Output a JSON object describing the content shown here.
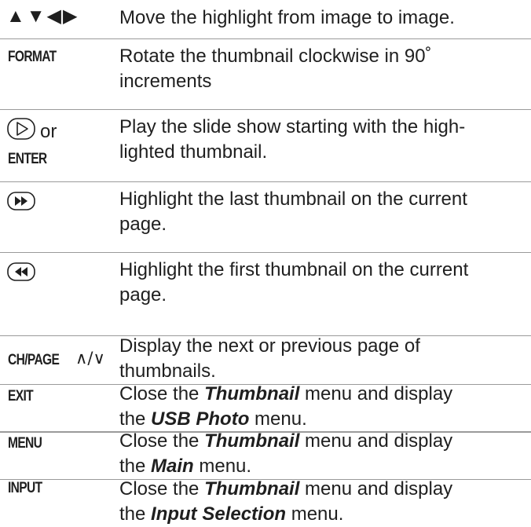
{
  "rows": [
    {
      "key_glyphs": "▲▼◀▶",
      "desc": "Move the highlight from image to image."
    },
    {
      "key": "FORMAT",
      "desc_l1": "Rotate the thumbnail clockwise in 90˚",
      "desc_l2": "increments"
    },
    {
      "key_or": "or",
      "key": "ENTER",
      "desc_l1": "Play the slide show starting with the high-",
      "desc_l2": "lighted thumbnail."
    },
    {
      "desc_l1": "Highlight the last thumbnail on the current",
      "desc_l2": "page."
    },
    {
      "desc_l1": "Highlight the first thumbnail on the current",
      "desc_l2": "page."
    },
    {
      "key": "CH/PAGE",
      "key_arrows": "∧/∨",
      "desc_l1": "Display the next or previous page of",
      "desc_l2": "thumbnails."
    },
    {
      "key": "EXIT",
      "desc_a": "Close the ",
      "desc_em1": "Thumbnail",
      "desc_b": " menu and display",
      "desc_c": "the ",
      "desc_em2": "USB Photo",
      "desc_d": " menu."
    },
    {
      "key": "MENU",
      "desc_a": "Close the ",
      "desc_em1": "Thumbnail",
      "desc_b": " menu and display",
      "desc_c": "the ",
      "desc_em2": "Main",
      "desc_d": " menu."
    },
    {
      "key": "INPUT",
      "desc_a": "Close the ",
      "desc_em1": "Thumbnail",
      "desc_b": " menu and display",
      "desc_c": "the ",
      "desc_em2": "Input Selection",
      "desc_d": " menu."
    }
  ]
}
